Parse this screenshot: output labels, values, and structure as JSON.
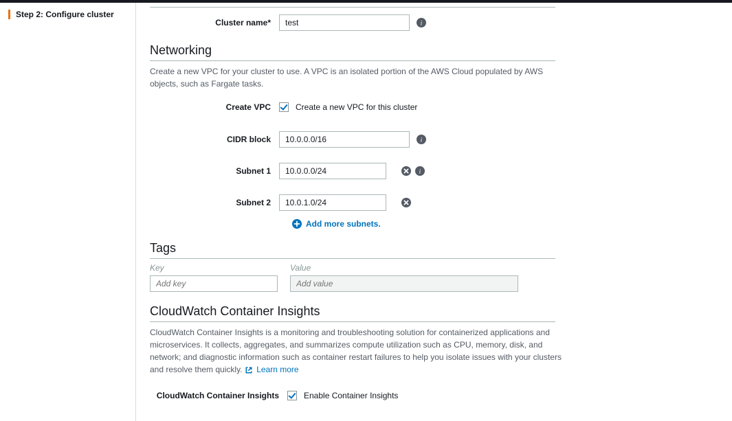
{
  "sidebar": {
    "step_label": "Step 2: Configure cluster"
  },
  "cluster": {
    "name_label": "Cluster name*",
    "name_value": "test"
  },
  "networking": {
    "title": "Networking",
    "desc": "Create a new VPC for your cluster to use. A VPC is an isolated portion of the AWS Cloud populated by AWS objects, such as Fargate tasks.",
    "create_vpc_label": "Create VPC",
    "create_vpc_check_label": "Create a new VPC for this cluster",
    "cidr_label": "CIDR block",
    "cidr_value": "10.0.0.0/16",
    "subnet1_label": "Subnet 1",
    "subnet1_value": "10.0.0.0/24",
    "subnet2_label": "Subnet 2",
    "subnet2_value": "10.0.1.0/24",
    "add_more_label": "Add more subnets."
  },
  "tags": {
    "title": "Tags",
    "key_header": "Key",
    "value_header": "Value",
    "key_placeholder": "Add key",
    "value_placeholder": "Add value"
  },
  "cloudwatch": {
    "title": "CloudWatch Container Insights",
    "desc": "CloudWatch Container Insights is a monitoring and troubleshooting solution for containerized applications and microservices. It collects, aggregates, and summarizes compute utilization such as CPU, memory, disk, and network; and diagnostic information such as container restart failures to help you isolate issues with your clusters and resolve them quickly. ",
    "learn_more": "Learn more",
    "insights_label": "CloudWatch Container Insights",
    "enable_label": "Enable Container Insights"
  }
}
